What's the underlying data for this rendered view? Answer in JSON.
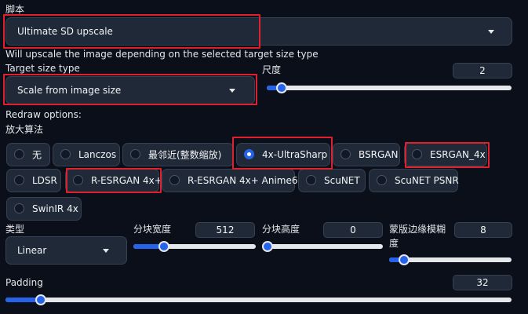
{
  "script": {
    "label": "脚本",
    "selected": "Ultimate SD upscale",
    "description": "Will upscale the image depending on the selected target size type"
  },
  "target_size": {
    "label": "Target size type",
    "selected": "Scale from image size"
  },
  "scale": {
    "label": "尺度",
    "value": "2",
    "fraction": 0.06
  },
  "redraw": {
    "label": "Redraw options:"
  },
  "upscaler": {
    "label": "放大算法",
    "options": [
      "无",
      "Lanczos",
      "最邻近(整数缩放)",
      "4x-UltraSharp",
      "BSRGAN",
      "ESRGAN_4x",
      "LDSR",
      "R-ESRGAN 4x+",
      "R-ESRGAN 4x+ Anime6B",
      "ScuNET",
      "ScuNET PSNR",
      "SwinIR 4x"
    ],
    "selected": "4x-UltraSharp"
  },
  "type": {
    "label": "类型",
    "selected": "Linear"
  },
  "tile_width": {
    "label": "分块宽度",
    "value": "512",
    "fraction": 0.25
  },
  "tile_height": {
    "label": "分块高度",
    "value": "0",
    "fraction": 0.0
  },
  "mask_blur": {
    "label": "蒙版边缘模糊度",
    "value": "8",
    "fraction": 0.12
  },
  "padding": {
    "label": "Padding",
    "value": "32",
    "fraction": 0.07
  },
  "colors": {
    "accent": "#2563eb",
    "highlight": "#e0202e",
    "background": "#0b0f19",
    "panel": "#1f2937"
  }
}
